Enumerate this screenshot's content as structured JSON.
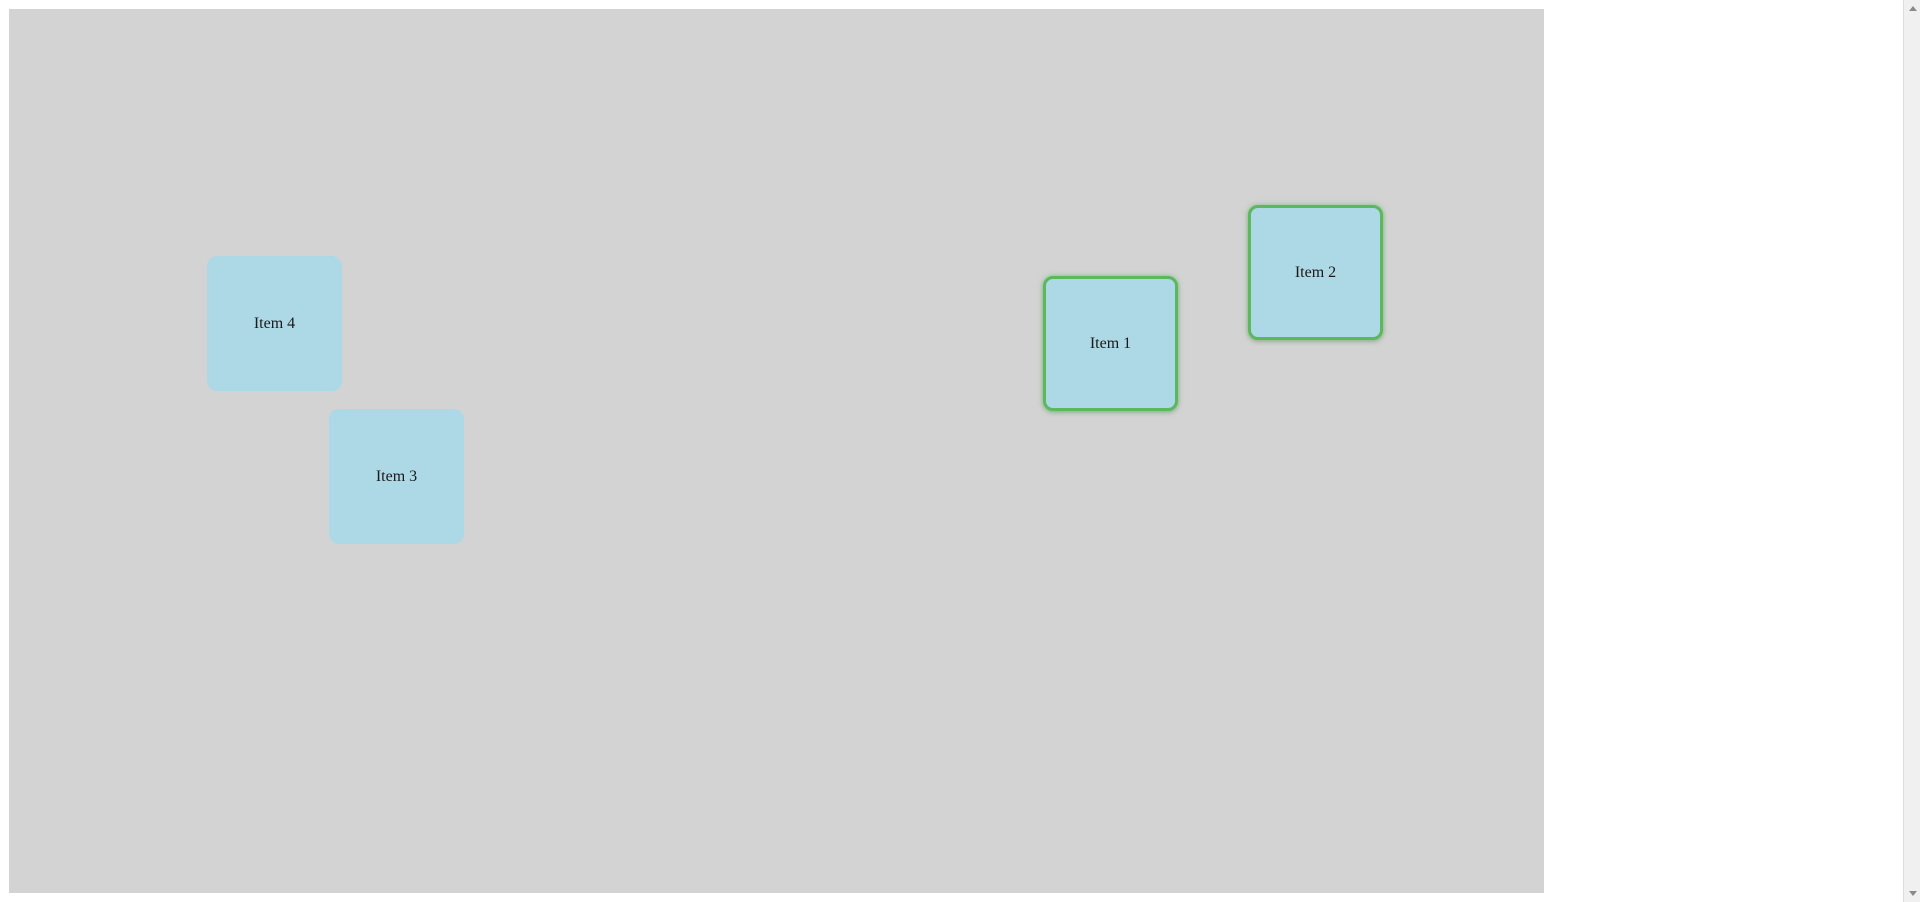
{
  "canvas": {
    "background": "#d3d3d3",
    "items": [
      {
        "id": "item-1",
        "label": "Item 1",
        "selected": true
      },
      {
        "id": "item-2",
        "label": "Item 2",
        "selected": true
      },
      {
        "id": "item-3",
        "label": "Item 3",
        "selected": false
      },
      {
        "id": "item-4",
        "label": "Item 4",
        "selected": false
      }
    ]
  },
  "colors": {
    "item_fill": "#add8e6",
    "selection_border": "#5cb85c"
  }
}
